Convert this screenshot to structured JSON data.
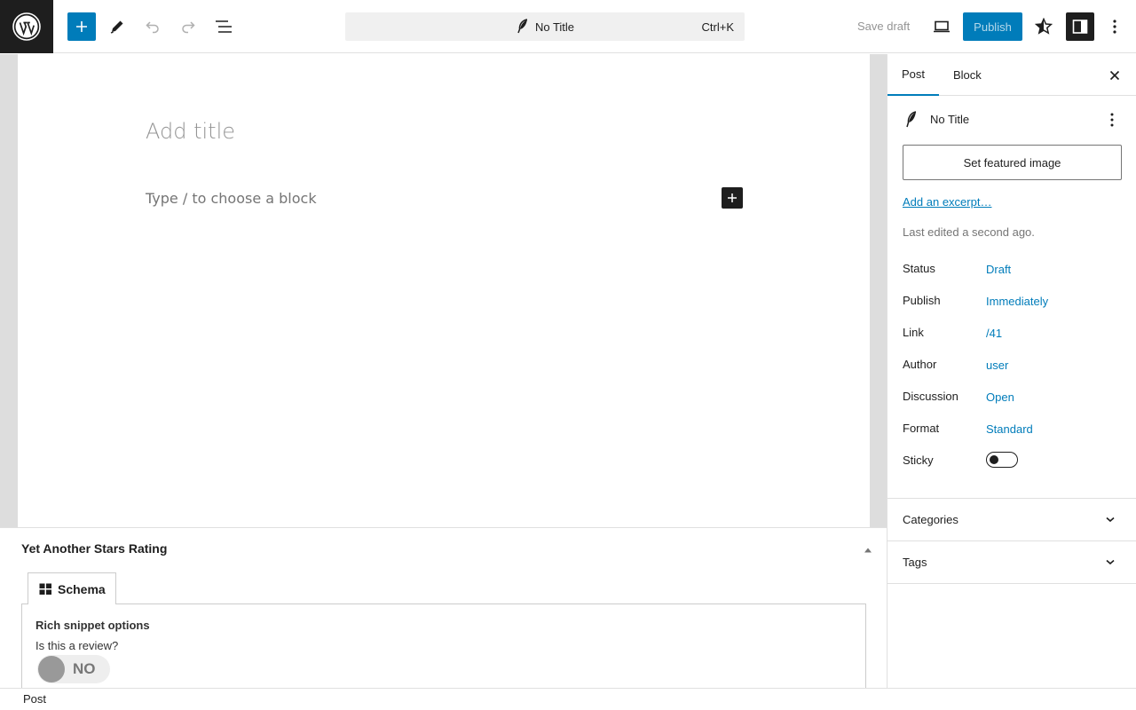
{
  "topbar": {
    "post_title": "No Title",
    "shortcut": "Ctrl+K",
    "save_draft": "Save draft",
    "publish": "Publish"
  },
  "editor": {
    "title_placeholder": "Add title",
    "block_placeholder": "Type / to choose a block"
  },
  "metabox": {
    "title": "Yet Another Stars Rating",
    "tab_label": "Schema",
    "rich_snippet_title": "Rich snippet options",
    "review_question": "Is this a review?",
    "review_toggle": "NO"
  },
  "footer": {
    "breadcrumb": "Post"
  },
  "sidebar": {
    "tabs": [
      "Post",
      "Block"
    ],
    "post_title": "No Title",
    "featured_image_button": "Set featured image",
    "excerpt_link": "Add an excerpt…",
    "last_edited": "Last edited a second ago.",
    "rows": [
      {
        "label": "Status",
        "value": "Draft"
      },
      {
        "label": "Publish",
        "value": "Immediately"
      },
      {
        "label": "Link",
        "value": "/41"
      },
      {
        "label": "Author",
        "value": "user"
      },
      {
        "label": "Discussion",
        "value": "Open"
      },
      {
        "label": "Format",
        "value": "Standard"
      }
    ],
    "sticky_label": "Sticky",
    "sticky_on": false,
    "panels": [
      "Categories",
      "Tags"
    ]
  },
  "colors": {
    "accent": "#007cba",
    "dark": "#1e1e1e"
  }
}
